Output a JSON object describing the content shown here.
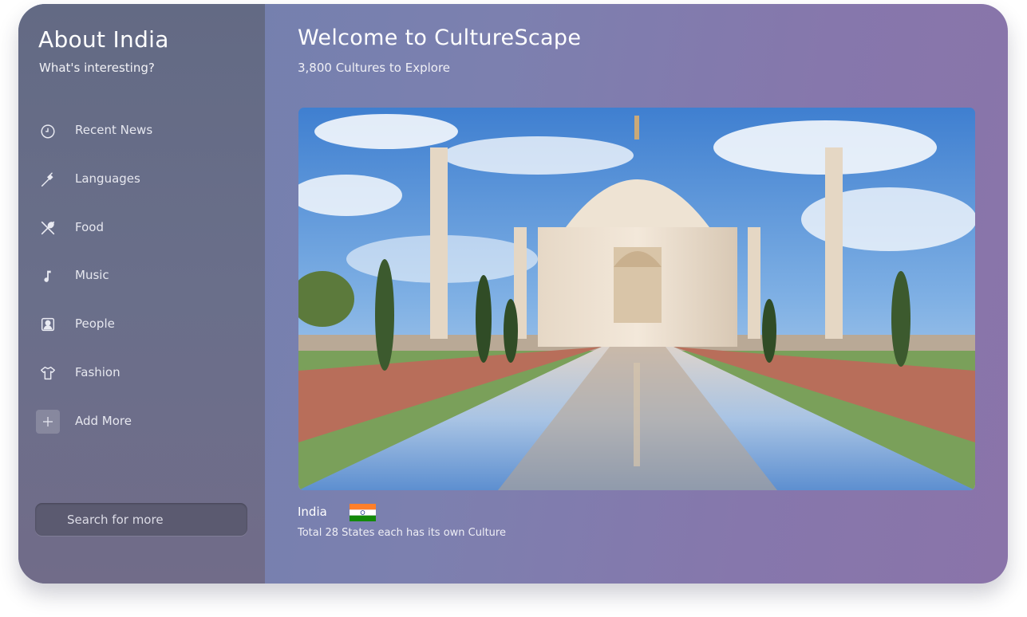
{
  "sidebar": {
    "title": "About India",
    "subtitle": "What's interesting?",
    "items": [
      {
        "label": "Recent News",
        "icon": "clock-icon"
      },
      {
        "label": "Languages",
        "icon": "pen-icon"
      },
      {
        "label": "Food",
        "icon": "utensils-icon"
      },
      {
        "label": "Music",
        "icon": "music-note-icon"
      },
      {
        "label": "People",
        "icon": "person-badge-icon"
      },
      {
        "label": "Fashion",
        "icon": "tshirt-icon"
      },
      {
        "label": "Add More",
        "icon": "plus-icon"
      }
    ],
    "search": {
      "placeholder": "Search for more"
    }
  },
  "main": {
    "title": "Welcome to CultureScape",
    "subtitle": "3,800 Cultures to Explore",
    "hero_image": "taj-mahal-photo",
    "country": {
      "name": "India",
      "flag_icon": "india-flag-icon",
      "description": "Total 28 States each has its own Culture"
    }
  },
  "colors": {
    "sidebar_bg": "#676c87",
    "main_gradient_start": "#6e7fae",
    "main_gradient_end": "#8a74a9",
    "search_bg": "#5b5a70",
    "text": "#ffffff"
  }
}
